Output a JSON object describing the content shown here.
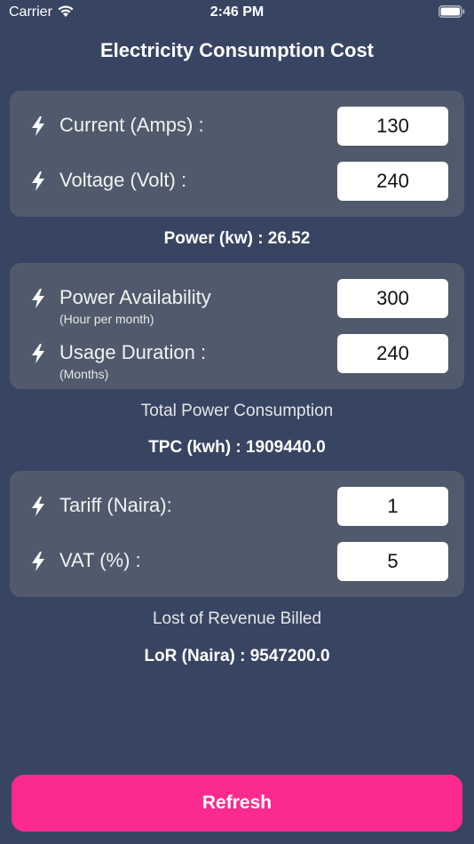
{
  "status_bar": {
    "carrier": "Carrier",
    "time": "2:46 PM"
  },
  "title": "Electricity Consumption Cost",
  "section1": {
    "current": {
      "label": "Current (Amps) :",
      "value": "130"
    },
    "voltage": {
      "label": "Voltage (Volt) :",
      "value": "240"
    }
  },
  "power_result": "Power (kw) : 26.52",
  "section2": {
    "availability": {
      "label": "Power Availability",
      "sublabel": "(Hour per month)",
      "value": "300"
    },
    "duration": {
      "label": "Usage Duration :",
      "sublabel": "(Months)",
      "value": "240"
    }
  },
  "tpc": {
    "label": "Total Power Consumption",
    "result": "TPC (kwh) : 1909440.0"
  },
  "section3": {
    "tariff": {
      "label": "Tariff (Naira):",
      "value": "1"
    },
    "vat": {
      "label": "VAT (%) :",
      "value": "5"
    }
  },
  "lor": {
    "label": "Lost of Revenue Billed",
    "result": "LoR (Naira) : 9547200.0"
  },
  "refresh_label": "Refresh",
  "colors": {
    "background": "#384562",
    "card": "#505a6c",
    "accent": "#fb2a8e"
  },
  "icons": [
    "wifi-icon",
    "battery-icon",
    "bolt-icon"
  ]
}
